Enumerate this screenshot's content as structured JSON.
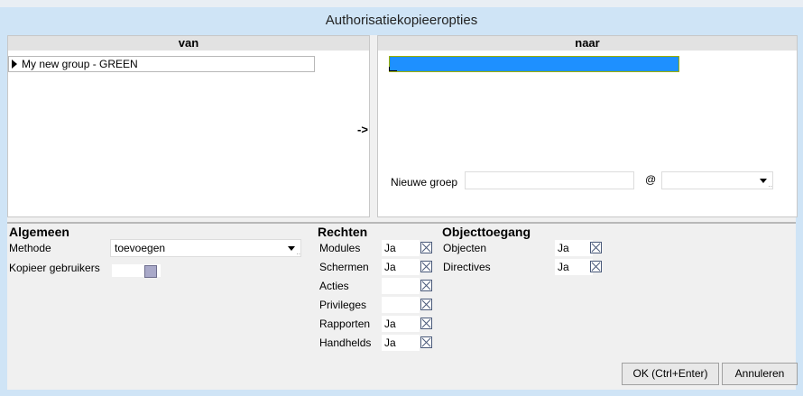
{
  "window": {
    "title": "Authorisatiekopieeropties"
  },
  "source": {
    "header": "van",
    "items": [
      "My new group - GREEN"
    ]
  },
  "transfer_arrow": "->",
  "destination": {
    "header": "naar",
    "nieuwe_groep_label": "Nieuwe groep",
    "nieuwe_groep_value": "",
    "at_label": "@",
    "at_value": ""
  },
  "algemeen": {
    "title": "Algemeen",
    "methode_label": "Methode",
    "methode_value": "toevoegen",
    "kopieer_label": "Kopieer gebruikers"
  },
  "rechten": {
    "title": "Rechten",
    "rows": [
      {
        "label": "Modules",
        "value": "Ja"
      },
      {
        "label": "Schermen",
        "value": "Ja"
      },
      {
        "label": "Acties",
        "value": ""
      },
      {
        "label": "Privileges",
        "value": ""
      },
      {
        "label": "Rapporten",
        "value": "Ja"
      },
      {
        "label": "Handhelds",
        "value": "Ja"
      }
    ]
  },
  "objecttoegang": {
    "title": "Objecttoegang",
    "rows": [
      {
        "label": "Objecten",
        "value": "Ja"
      },
      {
        "label": "Directives",
        "value": "Ja"
      }
    ]
  },
  "buttons": {
    "ok": "OK (Ctrl+Enter)",
    "cancel": "Annuleren"
  },
  "colors": {
    "selection": "#1e90ff",
    "frame": "#cfe4f6",
    "background": "#f0f0f0"
  }
}
